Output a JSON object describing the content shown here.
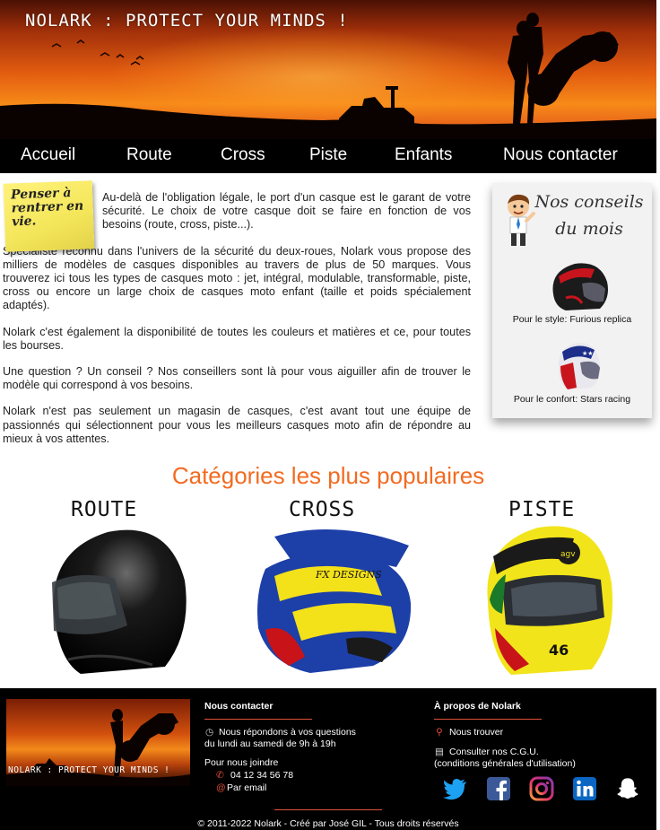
{
  "header": {
    "title": "NOLARK : PROTECT YOUR MINDS !"
  },
  "nav": {
    "items": [
      {
        "label": "Accueil"
      },
      {
        "label": "Route"
      },
      {
        "label": "Cross"
      },
      {
        "label": "Piste"
      },
      {
        "label": "Enfants"
      },
      {
        "label": "Nous contacter"
      }
    ]
  },
  "postit": {
    "text": "Penser à rentrer en vie."
  },
  "main": {
    "paragraphs": [
      "Au-delà de l'obligation légale, le port d'un casque est le garant de votre sécurité. Le choix de votre casque doit se faire en fonction de vos besoins (route, cross, piste...).",
      "Spécialiste reconnu dans l'univers de la sécurité du deux-roues, Nolark vous propose des milliers de modèles de casques disponibles au travers de plus de 50 marques. Vous trouverez ici tous les types de casques moto : jet, intégral, modulable, transformable, piste, cross ou encore un large choix de casques moto enfant (taille et poids spécialement adaptés).",
      "Nolark c'est également la disponibilité de toutes les couleurs et matières et ce, pour toutes les bourses.",
      "Une question ? Un conseil ? Nos conseillers sont là pour vous aiguiller afin de trouver le modèle qui correspond à vos besoins.",
      "Nolark n'est pas seulement un magasin de casques, c'est avant tout une équipe de passionnés qui sélectionnent pour vous les meilleurs casques moto afin de répondre au mieux à vos attentes."
    ]
  },
  "advice": {
    "title": "Nos conseils du mois",
    "items": [
      {
        "caption": "Pour le style: Furious replica"
      },
      {
        "caption": "Pour le confort: Stars racing"
      }
    ]
  },
  "categories": {
    "title": "Catégories les plus populaires",
    "items": [
      {
        "name": "ROUTE"
      },
      {
        "name": "CROSS"
      },
      {
        "name": "PISTE"
      }
    ]
  },
  "footer": {
    "logo_title": "NOLARK : PROTECT YOUR MINDS !",
    "contact": {
      "heading": "Nous contacter",
      "hours_line1": "Nous répondons à vos questions",
      "hours_line2": "du lundi au samedi de 9h à 19h",
      "join": "Pour nous joindre",
      "phone": "04 12 34 56 78",
      "email": "Par email"
    },
    "about": {
      "heading": "À propos de Nolark",
      "find": "Nous trouver",
      "cgu_line1": "Consulter nos C.G.U.",
      "cgu_line2": "(conditions générales d'utilisation)"
    },
    "social": [
      "twitter-icon",
      "facebook-icon",
      "instagram-icon",
      "linkedin-icon",
      "snapchat-icon"
    ],
    "copyright": "© 2011-2022 Nolark - Créé par José GIL - Tous droits réservés"
  },
  "colors": {
    "accent": "#f26b21",
    "footer_line": "#e0503a",
    "twitter": "#1da1f2",
    "facebook": "#3b5998",
    "linkedin": "#0a66c2"
  }
}
